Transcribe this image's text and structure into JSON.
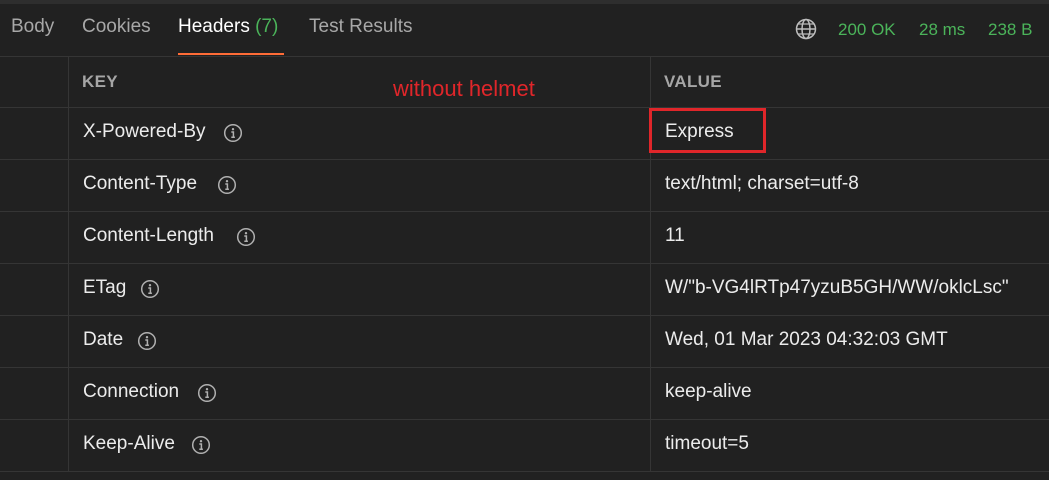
{
  "tabs": [
    {
      "label": "Body"
    },
    {
      "label": "Cookies"
    },
    {
      "label": "Headers",
      "count": "(7)",
      "active": true
    },
    {
      "label": "Test Results"
    }
  ],
  "status": {
    "code": "200 OK",
    "time": "28 ms",
    "size": "238 B"
  },
  "columns": {
    "key": "KEY",
    "value": "VALUE"
  },
  "annotation": "without helmet",
  "headers": [
    {
      "key": "X-Powered-By",
      "value": "Express"
    },
    {
      "key": "Content-Type",
      "value": "text/html; charset=utf-8"
    },
    {
      "key": "Content-Length",
      "value": "11"
    },
    {
      "key": "ETag",
      "value": "W/\"b-VG4lRTp47yzuB5GH/WW/oklcLsc\""
    },
    {
      "key": "Date",
      "value": "Wed, 01 Mar 2023 04:32:03 GMT"
    },
    {
      "key": "Connection",
      "value": "keep-alive"
    },
    {
      "key": "Keep-Alive",
      "value": "timeout=5"
    }
  ],
  "colors": {
    "accent": "#ff6c37",
    "status_ok": "#4bb45a",
    "annotation": "#e0262a"
  }
}
